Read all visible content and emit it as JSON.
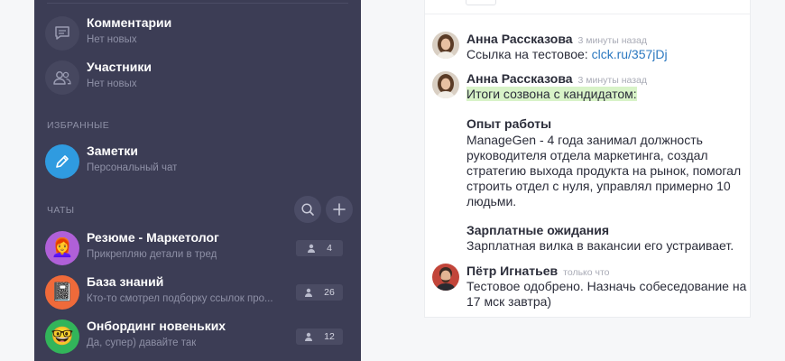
{
  "sidebar": {
    "items": [
      {
        "title": "Комментарии",
        "sub": "Нет новых",
        "icon": "comment-icon"
      },
      {
        "title": "Участники",
        "sub": "Нет новых",
        "icon": "people-icon"
      }
    ],
    "favorites_label": "ИЗБРАННЫЕ",
    "favorites": [
      {
        "title": "Заметки",
        "sub": "Персональный чат",
        "icon": "pencil-icon",
        "color": "#2f9be0"
      }
    ],
    "chats_label": "ЧАТЫ",
    "chats": [
      {
        "title": "Резюме - Маркетолог",
        "sub": "Прикрепляю детали в тред",
        "count": "4",
        "emoji": "👩‍🦰",
        "color": "#b060d8"
      },
      {
        "title": "База знаний",
        "sub": "Кто-то смотрел подборку ссылок про...",
        "count": "26",
        "emoji": "📓",
        "color": "#ef6a3a"
      },
      {
        "title": "Онбординг новеньких",
        "sub": "Да, супер) давайте так",
        "count": "12",
        "emoji": "🤓",
        "color": "#32b55a"
      }
    ]
  },
  "chat": {
    "messages": [
      {
        "author": "Анна Рассказова",
        "time": "3 минуты назад",
        "text_prefix": "Ссылка на тестовое: ",
        "link": "clck.ru/357jDj"
      },
      {
        "author": "Анна Рассказова",
        "time": "3 минуты назад",
        "highlight": "Итоги созвона с кандидатом:",
        "h1": "Опыт работы",
        "p1": "ManageGen - 4 года занимал должность руководителя отдела маркетинга, создал стратегию выхода продукта на рынок, помогал строить отдел с нуля, управлял примерно 10 людьми.",
        "h2": "Зарплатные ожидания",
        "p2": "Зарплатная вилка в вакансии его устраивает."
      },
      {
        "author": "Пётр Игнатьев",
        "time": "только что",
        "text": "Тестовое одобрено. Назначь собеседование на 17 мск завтра)"
      }
    ]
  }
}
